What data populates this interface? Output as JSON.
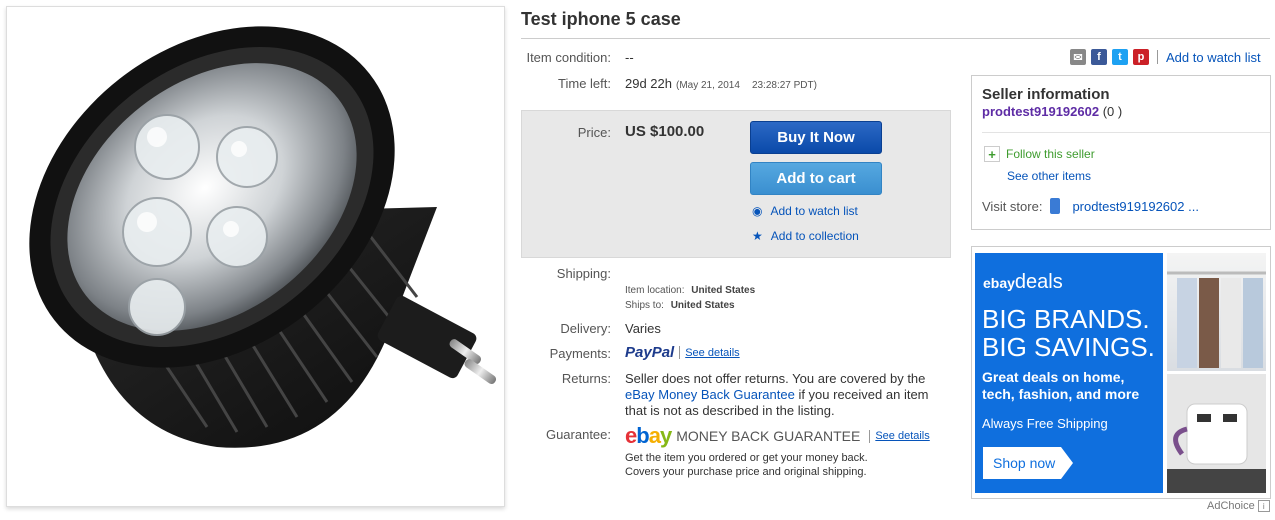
{
  "item": {
    "title": "Test iphone 5 case",
    "condition_label": "Item condition:",
    "condition_value": "--",
    "time_left_label": "Time left:",
    "time_left_value": "29d 22h",
    "time_left_date": "(May 21, 2014",
    "time_left_time": "23:28:27 PDT)"
  },
  "share": {
    "icons": [
      "email-icon",
      "facebook-icon",
      "twitter-icon",
      "pinterest-icon"
    ],
    "watch_link": "Add to watch list"
  },
  "buy": {
    "price_label": "Price:",
    "price_value": "US $100.00",
    "buy_now": "Buy It Now",
    "add_to_cart": "Add to cart",
    "add_watch": "Add to watch list",
    "add_collection": "Add to collection"
  },
  "shipping": {
    "label": "Shipping:",
    "location_label": "Item location:",
    "location_value": "United States",
    "ships_to_label": "Ships to:",
    "ships_to_value": "United States"
  },
  "delivery": {
    "label": "Delivery:",
    "value": "Varies"
  },
  "payments": {
    "label": "Payments:",
    "paypal": "PayPal",
    "see_details": "See details"
  },
  "returns": {
    "label": "Returns:",
    "text1": "Seller does not offer returns. You are covered by the",
    "guarantee_link": "eBay Money Back Guarantee",
    "text2": " if you received an item",
    "text3": "that is not as described in the listing."
  },
  "guarantee": {
    "label": "Guarantee:",
    "logo": "ebay",
    "logo_text": "MONEY BACK GUARANTEE",
    "see_details": "See details",
    "line1": "Get the item you ordered or get your money back.",
    "line2": "Covers your purchase price and original shipping."
  },
  "seller": {
    "heading": "Seller information",
    "name": "prodtest919192602",
    "score": " (0 )",
    "follow": "Follow this seller",
    "other_items": "See other items",
    "visit_store_label": "Visit store:",
    "store_name": "prodtest919192602 ..."
  },
  "ad": {
    "brand_ebay": "ebay",
    "brand_deals": "deals",
    "headline1": "BIG BRANDS.",
    "headline2": "BIG SAVINGS.",
    "sub1": "Great deals on home,",
    "sub2": "tech, fashion, and more",
    "shipping": "Always Free Shipping",
    "cta": "Shop now",
    "adchoice": "AdChoice"
  },
  "colors": {
    "accent": "#0654ba",
    "buy_button": "#0a4aa9",
    "cart_button": "#3a8fd0",
    "ad_blue": "#0f6fde",
    "seller_name": "#5e2ca5",
    "follow_green": "#3f9c2f"
  }
}
